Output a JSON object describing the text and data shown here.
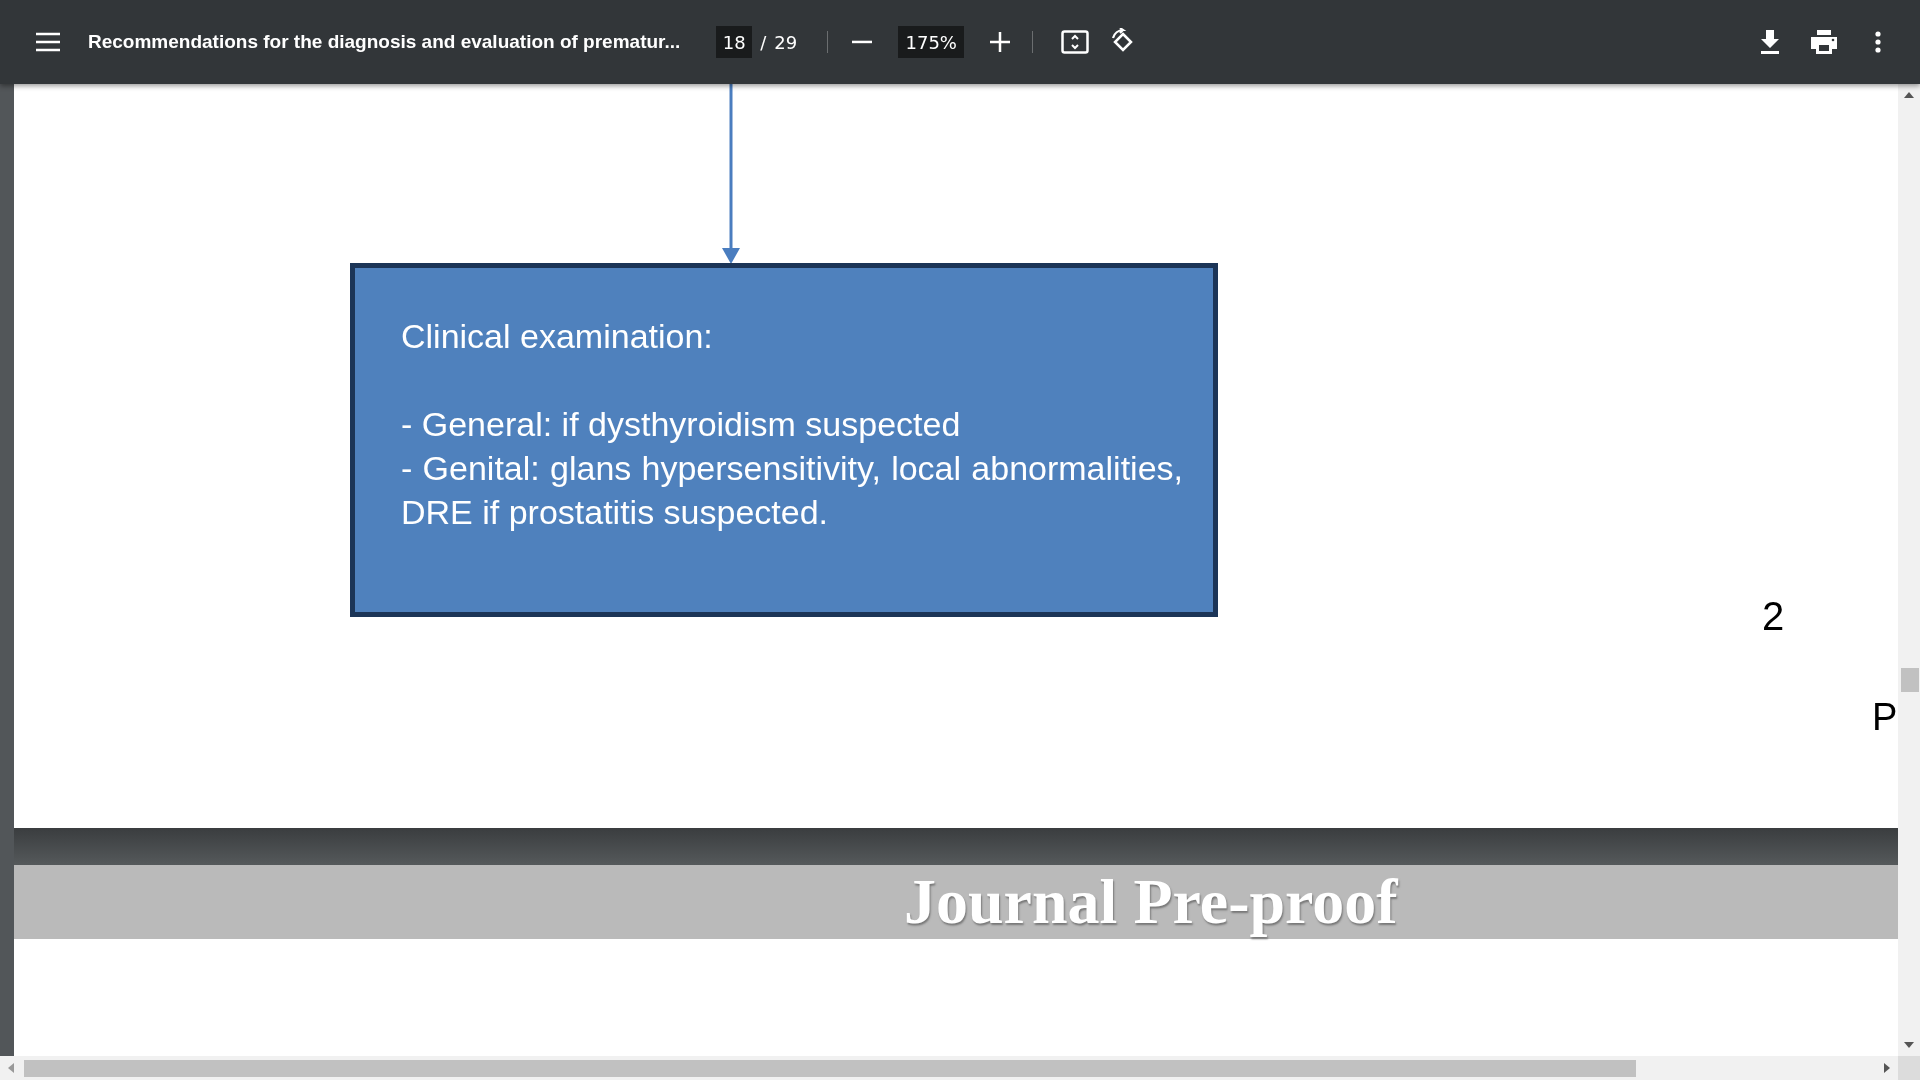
{
  "toolbar": {
    "title": "Recommendations for the diagnosis and evaluation of prematur...",
    "page_number": "18",
    "page_separator": "/",
    "page_count": "29",
    "zoom": "175%"
  },
  "page": {
    "box_title": "Clinical examination:",
    "box_items": [
      "- General: if dysthyroidism suspected",
      "- Genital: glans hypersensitivity, local abnormalities, DRE if prostatitis suspected."
    ],
    "page_mark": "2",
    "edge_text": "P"
  },
  "next_page": {
    "banner": "Journal Pre-proof"
  }
}
